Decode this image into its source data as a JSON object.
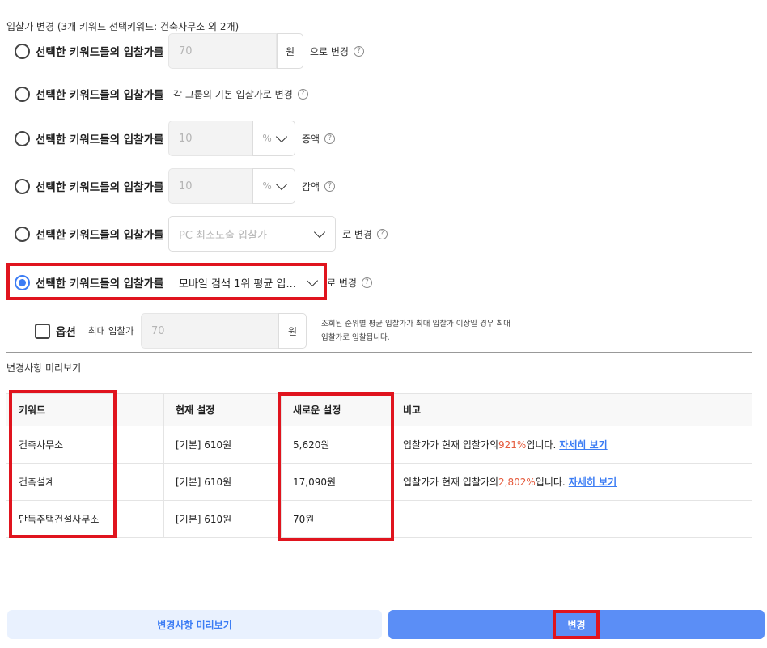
{
  "header": {
    "title": "입찰가 변경 (3개 키워드 선택키워드: 건축사무소 외 2개)"
  },
  "options": [
    {
      "label": "선택한 키워드들의 입찰가를",
      "input": "70",
      "unit": "원",
      "suffix": "으로 변경",
      "help": "?"
    },
    {
      "label": "선택한 키워드들의 입찰가를",
      "suffix": "각 그룹의 기본 입찰가로 변경",
      "help": "?"
    },
    {
      "label": "선택한 키워드들의 입찰가를",
      "input": "10",
      "unit": "%",
      "suffix": "증액",
      "help": "?"
    },
    {
      "label": "선택한 키워드들의 입찰가를",
      "input": "10",
      "unit": "%",
      "suffix": "감액",
      "help": "?"
    },
    {
      "label": "선택한 키워드들의 입찰가를",
      "select": "PC 최소노출 입찰가",
      "suffix": "로 변경",
      "help": "?"
    },
    {
      "label": "선택한 키워드들의 입찰가를",
      "select": "모바일 검색 1위 평균 입...",
      "suffix": "로 변경",
      "help": "?",
      "selected": true
    }
  ],
  "max_bid": {
    "option_label": "옵션",
    "label": "최대 입찰가",
    "input": "70",
    "unit": "원",
    "note": "조회된 순위별 평균 입찰가가 최대 입찰가 이상일 경우 최대 입찰가로 입찰됩니다."
  },
  "preview": {
    "title": "변경사항 미리보기",
    "columns": [
      "키워드",
      "현재 설정",
      "새로운 설정",
      "비고"
    ],
    "rows": [
      {
        "keyword": "건축사무소",
        "current": "[기본] 610원",
        "new": "5,620원",
        "note_pre": "입찰가가 현재 입찰가의 ",
        "note_pct": "921%",
        "note_post": " 입니다.",
        "link": "자세히 보기"
      },
      {
        "keyword": "건축설계",
        "current": "[기본] 610원",
        "new": "17,090원",
        "note_pre": "입찰가가 현재 입찰가의 ",
        "note_pct": "2,802%",
        "note_post": " 입니다.",
        "link": "자세히 보기"
      },
      {
        "keyword": "단독주택건설사무소",
        "current": "[기본] 610원",
        "new": "70원"
      }
    ]
  },
  "buttons": {
    "preview": "변경사항 미리보기",
    "apply": "변경"
  },
  "colors": {
    "accent": "#3b7cf4",
    "highlight": "#e0141e",
    "percent": "#e55a3c"
  },
  "icons": {
    "help": "question-circle-icon",
    "dropdown": "chevron-down-icon"
  }
}
